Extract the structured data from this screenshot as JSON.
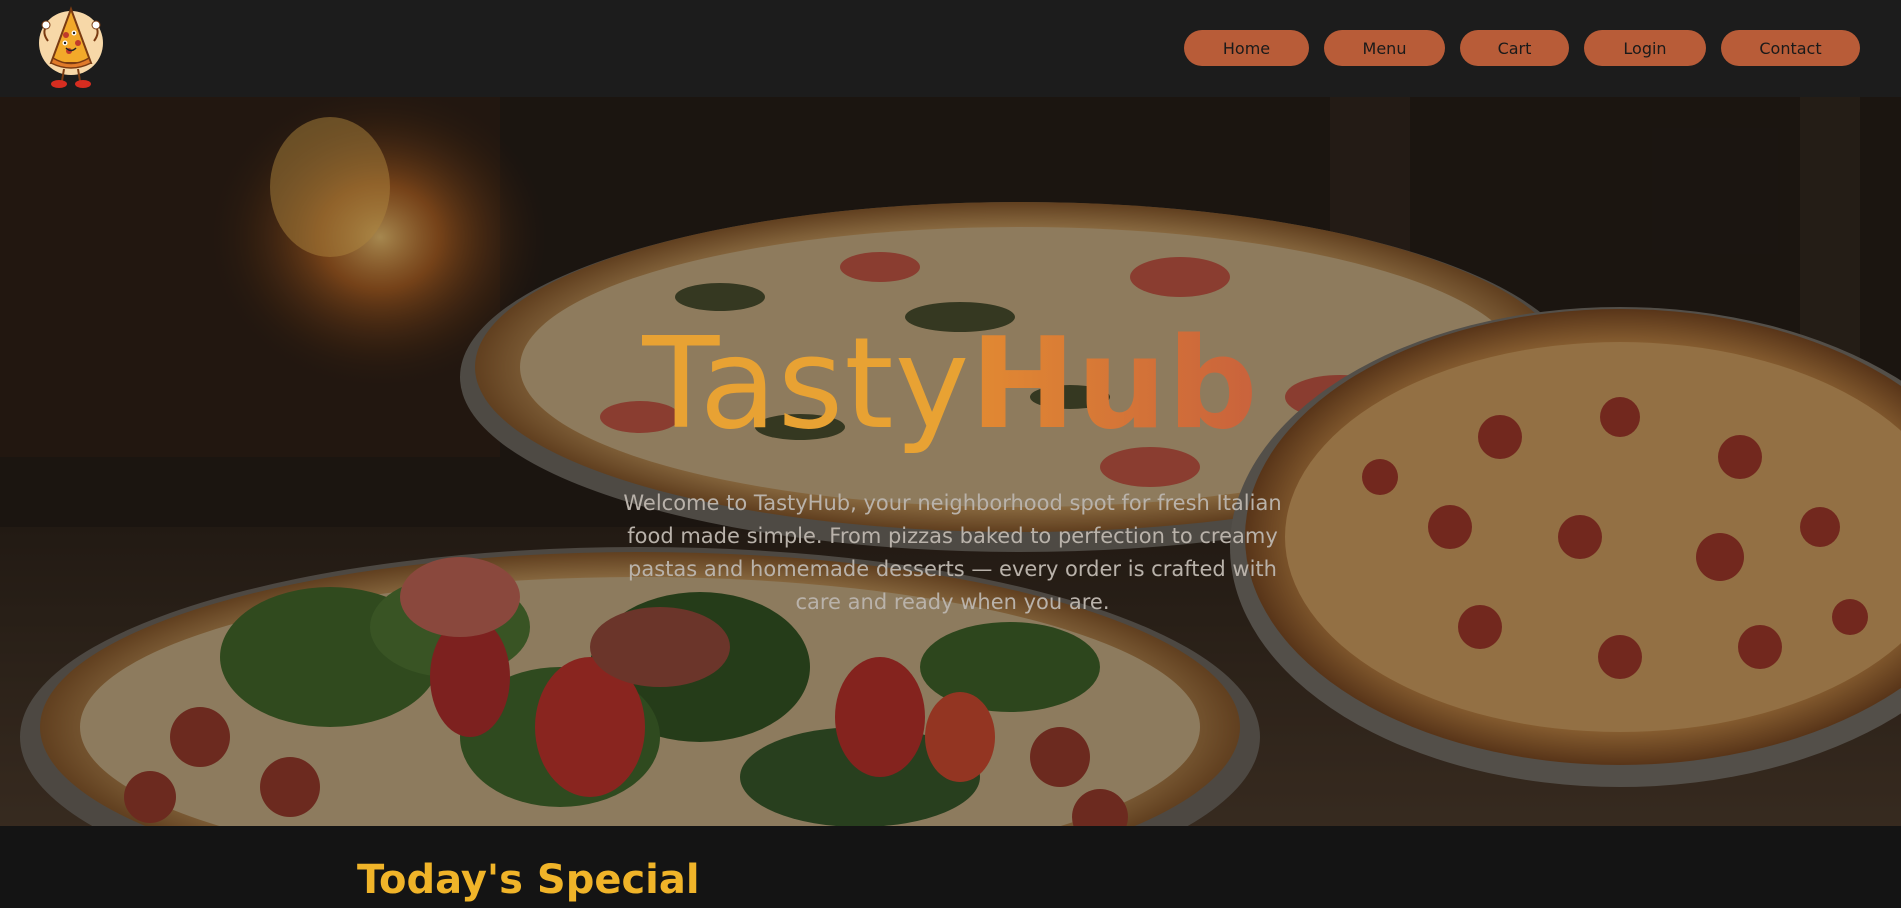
{
  "brand": {
    "logo_icon": "pizza-mascot-icon"
  },
  "nav": {
    "items": [
      {
        "label": "Home"
      },
      {
        "label": "Menu"
      },
      {
        "label": "Cart"
      },
      {
        "label": "Login"
      },
      {
        "label": "Contact"
      }
    ]
  },
  "hero": {
    "title_part1": "Tasty",
    "title_part2": "Hub",
    "description": "Welcome to TastyHub, your neighborhood spot for fresh Italian food made simple. From pizzas baked to perfection to creamy pastas and homemade desserts — every order is crafted with care and ready when you are."
  },
  "specials": {
    "title": "Today's Special"
  },
  "colors": {
    "accent": "#f0b429",
    "nav_button": "#b85c38",
    "header_bg": "#1c1c1c"
  }
}
